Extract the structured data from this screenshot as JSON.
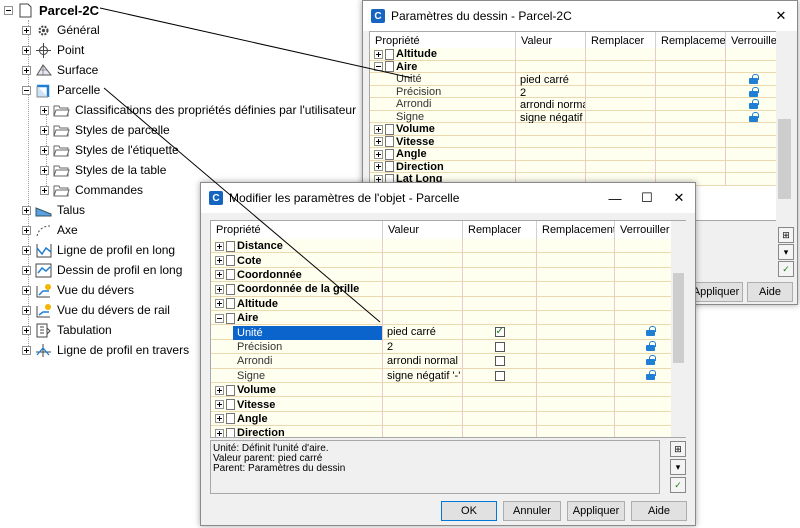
{
  "tree": {
    "root": "Parcel-2C",
    "items": [
      {
        "label": "Général",
        "icon": "gear-icon"
      },
      {
        "label": "Point",
        "icon": "point-icon"
      },
      {
        "label": "Surface",
        "icon": "surface-icon"
      },
      {
        "label": "Parcelle",
        "icon": "parcel-icon"
      },
      {
        "label": "Classifications des propriétés définies par l'utilisateur",
        "icon": "folder-icon"
      },
      {
        "label": "Styles de parcelle",
        "icon": "folder-icon"
      },
      {
        "label": "Styles de l'étiquette",
        "icon": "folder-icon"
      },
      {
        "label": "Styles de la table",
        "icon": "folder-icon"
      },
      {
        "label": "Commandes",
        "icon": "folder-icon"
      },
      {
        "label": "Talus",
        "icon": "slope-icon"
      },
      {
        "label": "Axe",
        "icon": "alignment-icon"
      },
      {
        "label": "Ligne de profil en long",
        "icon": "profile-icon"
      },
      {
        "label": "Dessin de profil en long",
        "icon": "profile-view-icon"
      },
      {
        "label": "Vue du dévers",
        "icon": "superelevation-icon"
      },
      {
        "label": "Vue du dévers de rail",
        "icon": "rail-superelevation-icon"
      },
      {
        "label": "Tabulation",
        "icon": "tabulation-icon"
      },
      {
        "label": "Ligne de profil en travers",
        "icon": "sample-line-icon"
      }
    ]
  },
  "win1": {
    "title": "Paramètres du dessin - Parcel-2C",
    "headers": [
      "Propriété",
      "Valeur",
      "Remplacer",
      "Remplacement...",
      "Verrouiller"
    ],
    "rows": [
      {
        "label": "Altitude",
        "type": "cat",
        "value": ""
      },
      {
        "label": "Aire",
        "type": "catopen",
        "value": ""
      },
      {
        "label": "Unité",
        "type": "sub",
        "value": "pied carré",
        "lock": true
      },
      {
        "label": "Précision",
        "type": "sub",
        "value": "2",
        "lock": true
      },
      {
        "label": "Arrondi",
        "type": "sub",
        "value": "arrondi normal",
        "lock": true
      },
      {
        "label": "Signe",
        "type": "sub",
        "value": "signe négatif '-'",
        "lock": true
      },
      {
        "label": "Volume",
        "type": "cat",
        "value": ""
      },
      {
        "label": "Vitesse",
        "type": "cat",
        "value": ""
      },
      {
        "label": "Angle",
        "type": "cat",
        "value": ""
      },
      {
        "label": "Direction",
        "type": "cat",
        "value": ""
      },
      {
        "label": "Lat Long",
        "type": "cat",
        "value": ""
      }
    ],
    "apply": "Appliquer",
    "help": "Aide"
  },
  "win2": {
    "title": "Modifier les paramètres de l'objet - Parcelle",
    "headers": [
      "Propriété",
      "Valeur",
      "Remplacer",
      "Remplacement...",
      "Verrouiller"
    ],
    "rows": [
      {
        "label": "Distance",
        "type": "cat",
        "value": ""
      },
      {
        "label": "Cote",
        "type": "cat",
        "value": ""
      },
      {
        "label": "Coordonnée",
        "type": "cat",
        "value": ""
      },
      {
        "label": "Coordonnée de la grille",
        "type": "cat",
        "value": ""
      },
      {
        "label": "Altitude",
        "type": "cat",
        "value": ""
      },
      {
        "label": "Aire",
        "type": "catopen",
        "value": ""
      },
      {
        "label": "Unité",
        "type": "sub",
        "value": "pied carré",
        "check": true,
        "lock": true,
        "selected": true
      },
      {
        "label": "Précision",
        "type": "sub",
        "value": "2",
        "check": false,
        "lock": true
      },
      {
        "label": "Arrondi",
        "type": "sub",
        "value": "arrondi normal",
        "check": false,
        "lock": true
      },
      {
        "label": "Signe",
        "type": "sub",
        "value": "signe négatif '-'",
        "check": false,
        "lock": true
      },
      {
        "label": "Volume",
        "type": "cat",
        "value": ""
      },
      {
        "label": "Vitesse",
        "type": "cat",
        "value": ""
      },
      {
        "label": "Angle",
        "type": "cat",
        "value": ""
      },
      {
        "label": "Direction",
        "type": "cat",
        "value": ""
      }
    ],
    "desc": [
      "Unité: Définit l'unité d'aire.",
      "Valeur parent: pied carré",
      "Parent: Paramètres du dessin"
    ],
    "ok": "OK",
    "cancel": "Annuler",
    "apply": "Appliquer",
    "help": "Aide"
  }
}
